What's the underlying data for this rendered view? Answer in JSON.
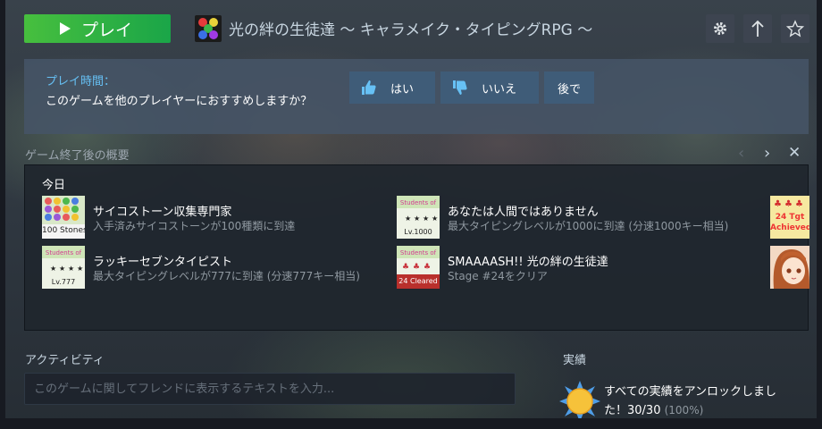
{
  "header": {
    "play_label": "プレイ",
    "game_title": "光の絆の生徒達 ～ キャラメイク・タイピングRPG ～"
  },
  "review": {
    "title": "プレイ時間：",
    "question": "このゲームを他のプレイヤーにおすすめしますか？",
    "yes_label": "はい",
    "no_label": "いいえ",
    "later_label": "後で"
  },
  "summary": {
    "section_title": "ゲーム終了後の概要",
    "today_label": "今日",
    "achievements": [
      {
        "title": "サイコストーン収集専門家",
        "desc": "入手済みサイコストーンが100種類に到達",
        "icon_text": "100 Stones"
      },
      {
        "title": "あなたは人間ではありません",
        "desc": "最大タイピングレベルが1000に到達 (分速1000キー相当)",
        "icon_text": "Lv.1000"
      },
      {
        "title": "ラッキーセブンタイピスト",
        "desc": "最大タイピングレベルが777に到達 (分速777キー相当)",
        "icon_text": "Lv.777"
      },
      {
        "title": "SMAAAASH!! 光の絆の生徒達",
        "desc": "Stage #24をクリア",
        "icon_text": "24 Cleared"
      }
    ],
    "partial_icon_1_text": "24 Tgt Achieved"
  },
  "activity": {
    "label": "アクティビティ",
    "placeholder": "このゲームに関してフレンドに表示するテキストを入力..."
  },
  "achievements_box": {
    "label": "実績",
    "text": "すべての実績をアンロックしました！30/30",
    "percent": "(100%)"
  }
}
